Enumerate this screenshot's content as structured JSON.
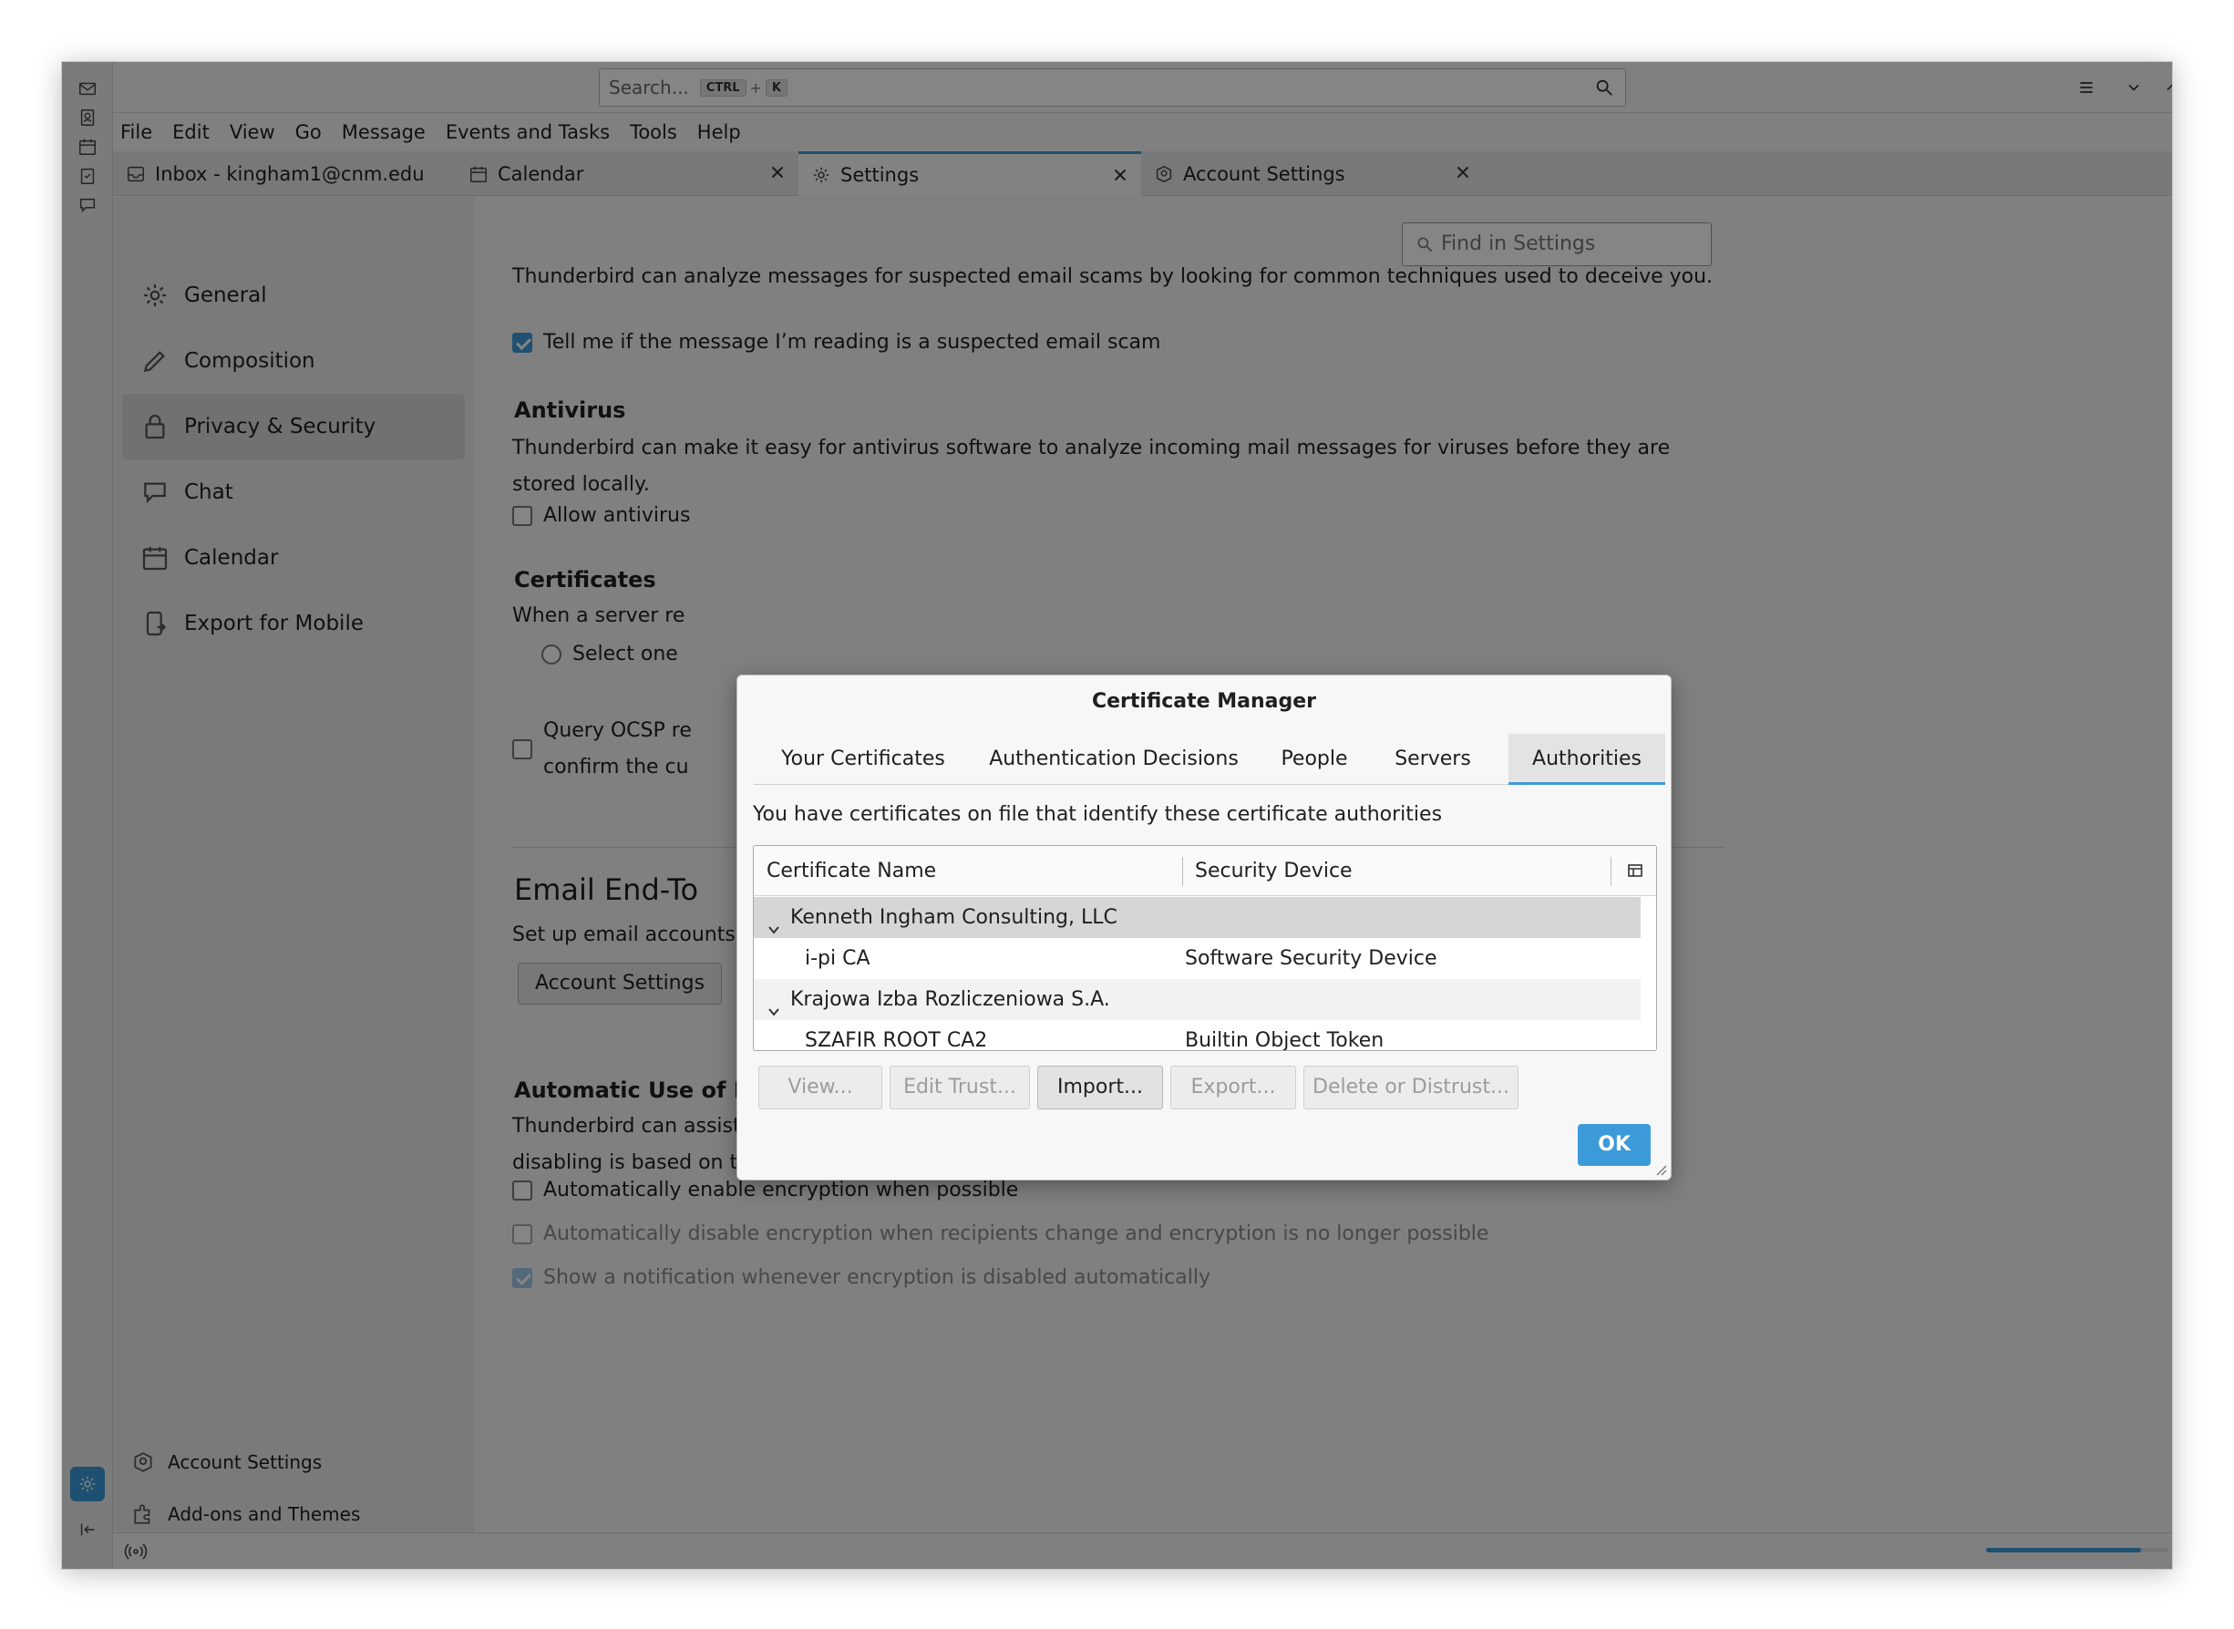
{
  "titlebar": {
    "search_placeholder": "Search...",
    "shortcut_key1": "CTRL",
    "shortcut_plus": "+",
    "shortcut_key2": "K"
  },
  "menu": [
    "File",
    "Edit",
    "View",
    "Go",
    "Message",
    "Events and Tasks",
    "Tools",
    "Help"
  ],
  "tabs": [
    {
      "label": "Inbox - kingham1@cnm.edu",
      "icon": "inbox-icon"
    },
    {
      "label": "Calendar",
      "icon": "calendar-icon"
    },
    {
      "label": "Settings",
      "icon": "gear-icon"
    },
    {
      "label": "Account Settings",
      "icon": "account-settings-icon"
    }
  ],
  "settings_nav": {
    "items": [
      "General",
      "Composition",
      "Privacy & Security",
      "Chat",
      "Calendar",
      "Export for Mobile"
    ],
    "account_settings": "Account Settings",
    "addons": "Add-ons and Themes"
  },
  "pane": {
    "find_placeholder": "Find in Settings",
    "scam_desc": "Thunderbird can analyze messages for suspected email scams by looking for common techniques used to deceive you.",
    "scam_check": "Tell me if the message I’m reading is a suspected email scam",
    "antivirus_title": "Antivirus",
    "antivirus_desc": "Thunderbird can make it easy for antivirus software to analyze incoming mail messages for viruses before they are stored locally.",
    "antivirus_check": "Allow antivirus",
    "certs_title": "Certificates",
    "certs_desc": "When a server re",
    "select_one": "Select one",
    "ocsp_line1": "Query OCSP re",
    "ocsp_line2": "confirm the cu",
    "e2e_title": "Email End-To",
    "e2e_desc": "Set up email accounts and identities for End-To-End Encryption in Account Settings.",
    "account_settings_btn": "Account Settings",
    "auto_title": "Automatic Use of Encryption",
    "auto_desc": "Thunderbird can assist by automatically enabling or disabling encryption while composing an email. Auto enabling/ disabling is based on the availability of valid and accepted correspondents’ keys or certificates.",
    "auto_enable": "Automatically enable encryption when possible",
    "auto_disable": "Automatically disable encryption when recipients change and encryption is no longer possible",
    "auto_notify": "Show a notification whenever encryption is disabled automatically"
  },
  "dialog": {
    "title": "Certificate Manager",
    "tabs": [
      "Your Certificates",
      "Authentication Decisions",
      "People",
      "Servers",
      "Authorities"
    ],
    "description": "You have certificates on file that identify these certificate authorities",
    "columns": [
      "Certificate Name",
      "Security Device"
    ],
    "rows": [
      {
        "name": "Kenneth Ingham Consulting, LLC",
        "device": ""
      },
      {
        "name": "i-pi CA",
        "device": "Software Security Device"
      },
      {
        "name": "Krajowa Izba Rozliczeniowa S.A.",
        "device": ""
      },
      {
        "name": "SZAFIR ROOT CA2",
        "device": "Builtin Object Token"
      }
    ],
    "buttons": [
      "View...",
      "Edit Trust...",
      "Import...",
      "Export...",
      "Delete or Distrust..."
    ],
    "ok": "OK"
  },
  "colors": {
    "accent": "#3d9ad8"
  },
  "status": {
    "progress": 0.85
  }
}
